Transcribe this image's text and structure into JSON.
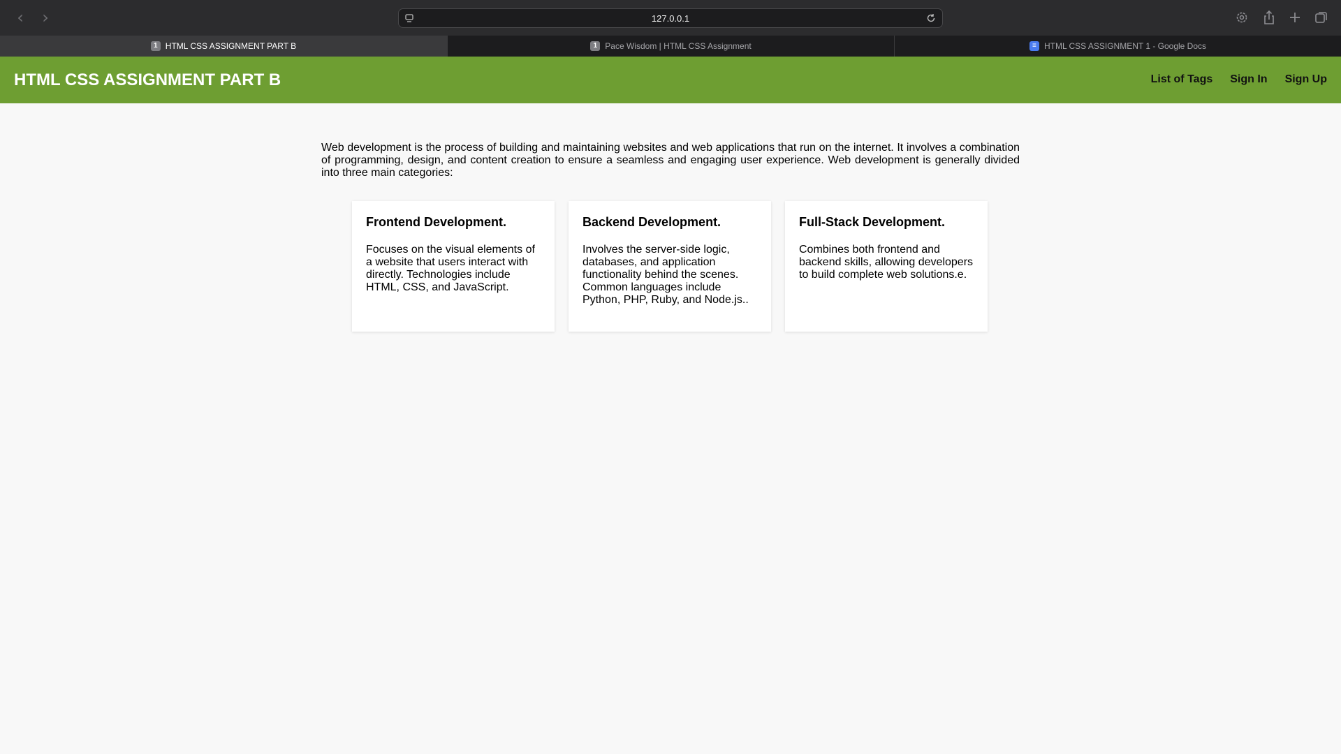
{
  "browser": {
    "url": "127.0.0.1",
    "tabs": [
      {
        "label": "HTML CSS ASSIGNMENT PART B",
        "favicon": "1",
        "active": true
      },
      {
        "label": "Pace Wisdom | HTML CSS Assignment",
        "favicon": "1",
        "active": false
      },
      {
        "label": "HTML CSS ASSIGNMENT 1 - Google Docs",
        "favicon": "docs-icon",
        "active": false
      }
    ]
  },
  "header": {
    "title": "HTML CSS ASSIGNMENT PART B",
    "nav": [
      "List of Tags",
      "Sign In",
      "Sign Up"
    ],
    "bg_color": "#6e9e32"
  },
  "intro": "Web development is the process of building and maintaining websites and web applications that run on the internet. It involves a combination of programming, design, and content creation to ensure a seamless and engaging user experience. Web development is generally divided into three main categories:",
  "cards": [
    {
      "title": "Frontend Development.",
      "text": "Focuses on the visual elements of a website that users interact with directly. Technologies include HTML, CSS, and JavaScript."
    },
    {
      "title": "Backend Development.",
      "text": "Involves the server-side logic, databases, and application functionality behind the scenes. Common languages include Python, PHP, Ruby, and Node.js.."
    },
    {
      "title": "Full-Stack Development.",
      "text": "Combines both frontend and backend skills, allowing developers to build complete web solutions.e."
    }
  ]
}
